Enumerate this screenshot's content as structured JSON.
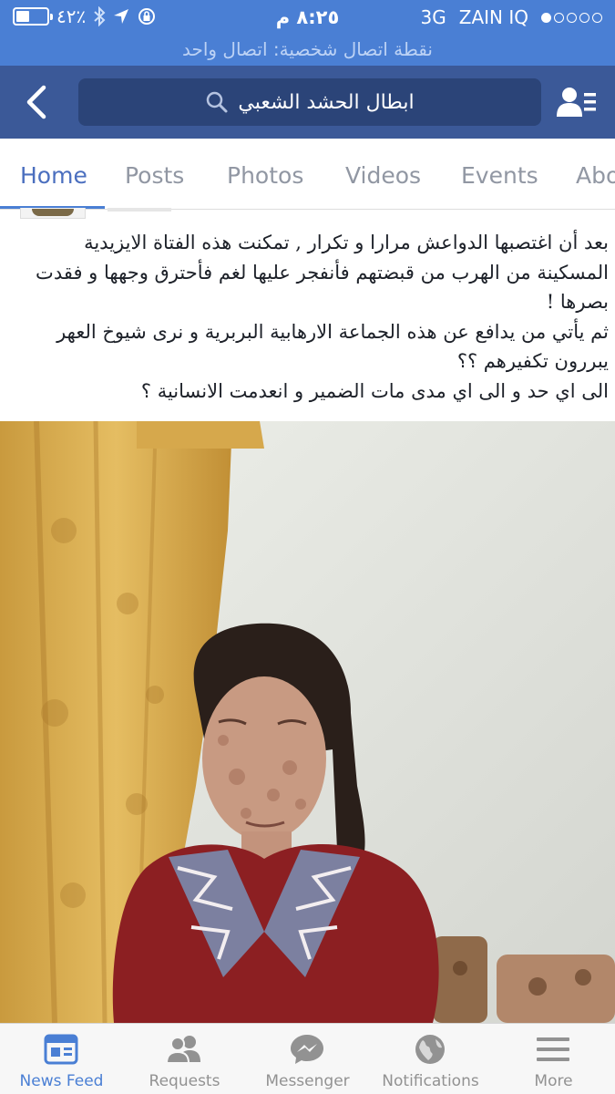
{
  "status_bar": {
    "battery_percent_text": "٤٢٪",
    "battery_level": 0.42,
    "time": "٨:٢٥ م",
    "network": "3G",
    "carrier": "ZAIN IQ",
    "signal_bars": 1
  },
  "hotspot_banner": "نقطة اتصال شخصية: اتصال واحد",
  "navbar": {
    "search_text": "ابطال الحشد الشعبي",
    "bar_color": "#3b5998",
    "status_color": "#4a7fd4"
  },
  "tabs": [
    {
      "label": "Home",
      "active": true
    },
    {
      "label": "Posts"
    },
    {
      "label": "Photos"
    },
    {
      "label": "Videos"
    },
    {
      "label": "Events"
    },
    {
      "label": "Abo"
    }
  ],
  "post": {
    "lines": [
      "بعد أن اغتصبها الدواعش مرارا و تكرار , تمكنت هذه الفتاة الايزيدية",
      "المسكينة من الهرب من قبضتهم فأنفجر عليها لغم فأحترق وجهها و فقدت",
      "بصرها !",
      "ثم يأتي من يدافع عن هذه الجماعة الارهابية البربرية و نرى شيوخ العهر",
      "يبررون  تكفيرهم ؟؟",
      "الى اي حد و الى اي مدى مات الضمير و انعدمت الانسانية ؟"
    ]
  },
  "bottom_tabs": [
    {
      "label": "News Feed",
      "icon": "news-feed-icon",
      "active": true
    },
    {
      "label": "Requests",
      "icon": "friend-requests-icon"
    },
    {
      "label": "Messenger",
      "icon": "messenger-icon"
    },
    {
      "label": "Notifications",
      "icon": "globe-icon"
    },
    {
      "label": "More",
      "icon": "hamburger-menu-icon"
    }
  ]
}
